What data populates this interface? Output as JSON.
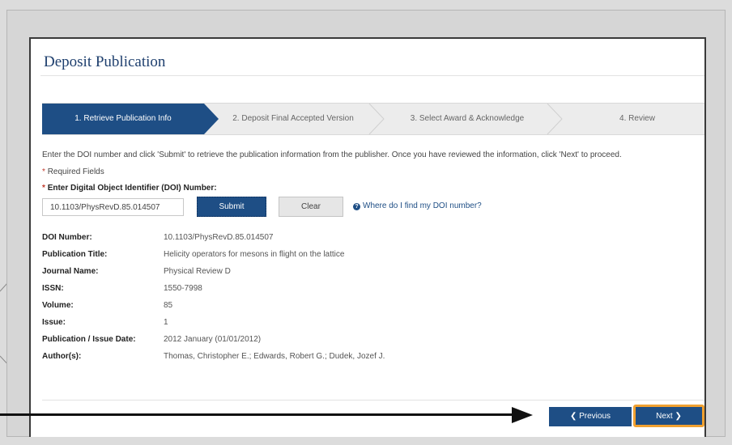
{
  "page": {
    "heading": "Deposit Publication",
    "intro_text": "Enter the DOI number and click 'Submit' to retrieve the publication information from the publisher. Once you have reviewed the information, click 'Next' to proceed.",
    "required_star": "*",
    "required_text": "Required Fields"
  },
  "steps": [
    {
      "label": "1. Retrieve Publication Info",
      "active": true
    },
    {
      "label": "2. Deposit Final Accepted Version",
      "active": false
    },
    {
      "label": "3. Select Award & Acknowledge",
      "active": false
    },
    {
      "label": "4. Review",
      "active": false
    }
  ],
  "doi_form": {
    "label": "Enter Digital Object Identifier (DOI) Number:",
    "value": "10.1103/PhysRevD.85.014507",
    "submit_label": "Submit",
    "clear_label": "Clear",
    "help_link": "Where do I find my DOI number?"
  },
  "details": [
    {
      "label": "DOI Number:",
      "value": "10.1103/PhysRevD.85.014507"
    },
    {
      "label": "Publication Title:",
      "value": "Helicity operators for mesons in flight on the lattice"
    },
    {
      "label": "Journal Name:",
      "value": "Physical Review D"
    },
    {
      "label": "ISSN:",
      "value": "1550-7998"
    },
    {
      "label": "Volume:",
      "value": "85"
    },
    {
      "label": "Issue:",
      "value": "1"
    },
    {
      "label": "Publication / Issue Date:",
      "value": "2012 January (01/01/2012)"
    },
    {
      "label": "Author(s):",
      "value": "Thomas, Christopher E.; Edwards, Robert G.; Dudek, Jozef J."
    }
  ],
  "nav": {
    "previous_label": "Previous",
    "next_label": "Next"
  },
  "colors": {
    "primary": "#1e4e85",
    "highlight": "#f0a030",
    "required": "#c0392b"
  }
}
